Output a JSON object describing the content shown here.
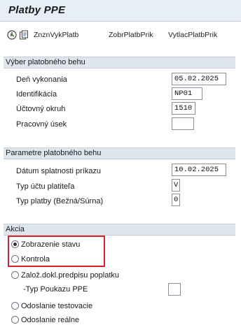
{
  "title": "Platby PPE",
  "toolbar": {
    "btn1": "ZnznVykPlatb",
    "btn2": "ZobrPlatbPrik",
    "btn3": "VytlacPlatbPrik"
  },
  "section1": {
    "header": "Výber platobného behu",
    "rows": [
      {
        "label": "Deň vykonania",
        "value": "05.02.2025"
      },
      {
        "label": "Identifikácia",
        "value": "NP01"
      },
      {
        "label": "Účtovný okruh",
        "value": "1510"
      },
      {
        "label": "Pracovný úsek",
        "value": ""
      }
    ]
  },
  "section2": {
    "header": "Parametre platobného behu",
    "rows": [
      {
        "label": "Dátum splatnosti príkazu",
        "value": "10.02.2025"
      },
      {
        "label": "Typ účtu platiteľa",
        "value": "V"
      },
      {
        "label": "Typ platby (Bežná/Súrna)",
        "value": "0"
      }
    ]
  },
  "section3": {
    "header": "Akcia",
    "options": [
      {
        "label": "Zobrazenie stavu",
        "selected": true
      },
      {
        "label": "Kontrola",
        "selected": false
      },
      {
        "label": "Založ.dokl.predpisu poplatku",
        "selected": false
      },
      {
        "label": "Odoslanie testovacie",
        "selected": false
      },
      {
        "label": "Odoslanie reálne",
        "selected": false
      }
    ],
    "sub_field_label": "-Typ Poukazu PPE",
    "sub_field_value": ""
  },
  "colors": {
    "highlight": "#d9242c",
    "header_bg": "#dfe6ee",
    "title_bg": "#e8eef5"
  }
}
